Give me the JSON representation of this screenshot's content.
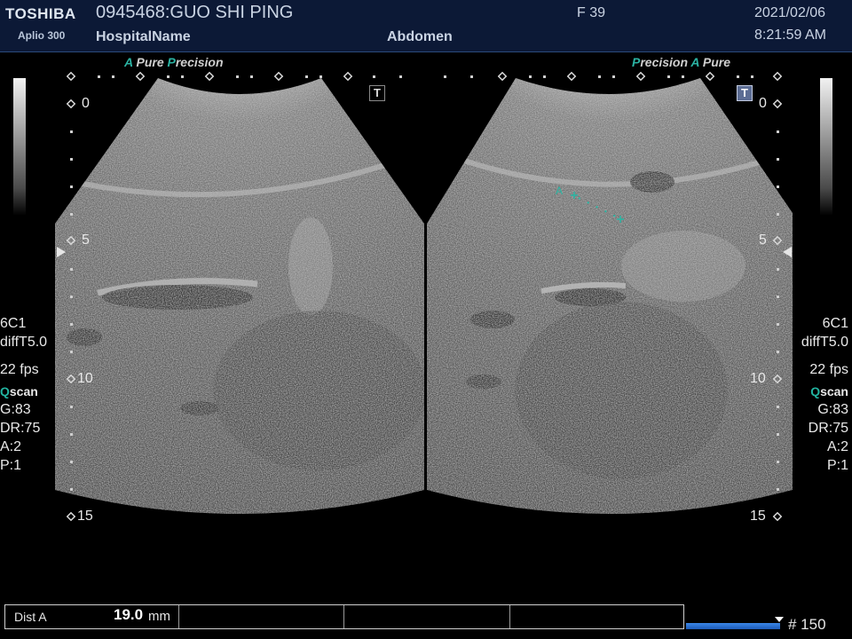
{
  "header": {
    "brand": "TOSHIBA",
    "model": "Aplio 300",
    "patient": "0945468:GUO SHI PING",
    "hospital": "HospitalName",
    "exam": "Abdomen",
    "frame": "F  39",
    "date": "2021/02/06",
    "time": "8:21:59 AM"
  },
  "left_view": {
    "pp_a": "A",
    "pp_pure": "Pure",
    "pp_p": "P",
    "pp_precision": "recision",
    "t_button": "T",
    "depth_marks": [
      "0",
      "5",
      "10",
      "15"
    ]
  },
  "right_view": {
    "pp_p": "P",
    "pp_precision": "recision",
    "pp_a": "A",
    "pp_pure": "Pure",
    "t_button": "T",
    "depth_marks": [
      "0",
      "5",
      "10",
      "15"
    ]
  },
  "params": {
    "probe": "6C1",
    "mode": "diffT5.0",
    "fps": "22 fps",
    "qscan_q": "Q",
    "qscan_rest": "scan",
    "gain": "G:83",
    "dr": "DR:75",
    "a": "A:2",
    "p": "P:1"
  },
  "measurement": {
    "caliper_label": "A",
    "label": "Dist A",
    "value": "19.0",
    "unit": "mm"
  },
  "cine": {
    "count": "# 150",
    "fill_fraction": 1.0
  },
  "colors": {
    "header_bg": "#0c1936",
    "accent_teal": "#2bb3a3",
    "cine_blue": "#3a86e6"
  }
}
